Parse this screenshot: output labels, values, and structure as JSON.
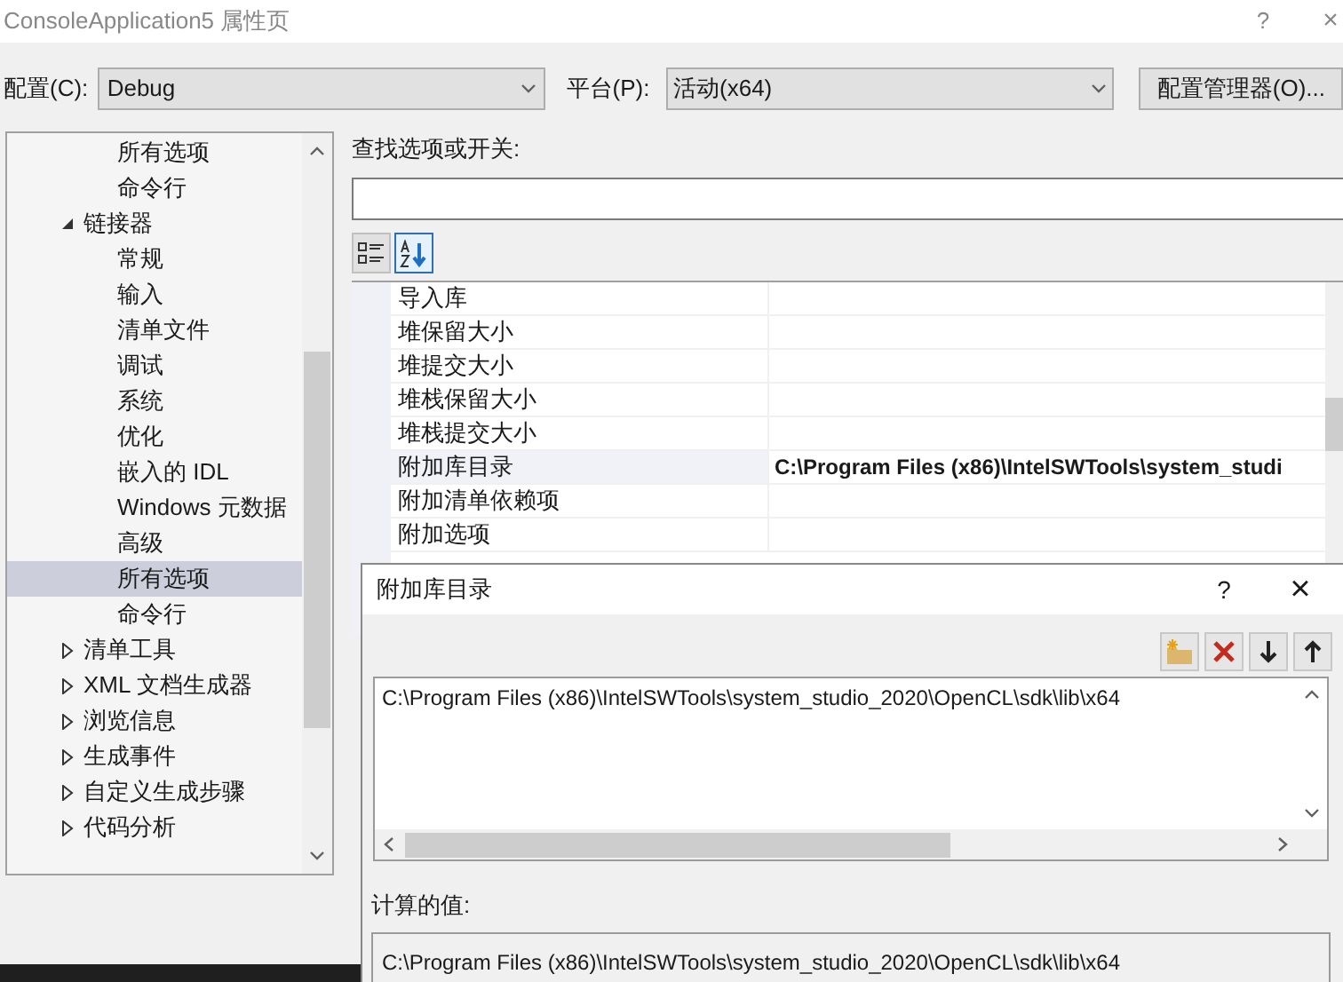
{
  "window": {
    "title": "ConsoleApplication5 属性页",
    "help": "?",
    "close": "×"
  },
  "config": {
    "label": "配置(C):",
    "value": "Debug"
  },
  "platform": {
    "label": "平台(P):",
    "value": "活动(x64)"
  },
  "config_manager_button": "配置管理器(O)...",
  "tree": [
    {
      "children": [
        {
          "label": "所有选项",
          "selected": false
        },
        {
          "label": "命令行",
          "selected": false
        }
      ]
    },
    {
      "label": "链接器",
      "expanded": true,
      "selected": false,
      "children": [
        {
          "label": "常规",
          "selected": false
        },
        {
          "label": "输入",
          "selected": false
        },
        {
          "label": "清单文件",
          "selected": false
        },
        {
          "label": "调试",
          "selected": false
        },
        {
          "label": "系统",
          "selected": false
        },
        {
          "label": "优化",
          "selected": false
        },
        {
          "label": "嵌入的 IDL",
          "selected": false
        },
        {
          "label": "Windows 元数据",
          "selected": false
        },
        {
          "label": "高级",
          "selected": false
        },
        {
          "label": "所有选项",
          "selected": true
        },
        {
          "label": "命令行",
          "selected": false
        }
      ]
    },
    {
      "label": "清单工具",
      "expanded": false,
      "selected": false
    },
    {
      "label": "XML 文档生成器",
      "expanded": false,
      "selected": false
    },
    {
      "label": "浏览信息",
      "expanded": false,
      "selected": false
    },
    {
      "label": "生成事件",
      "expanded": false,
      "selected": false
    },
    {
      "label": "自定义生成步骤",
      "expanded": false,
      "selected": false
    },
    {
      "label": "代码分析",
      "expanded": false,
      "selected": false
    }
  ],
  "search": {
    "label": "查找选项或开关:"
  },
  "view_buttons": [
    {
      "kind": "categorized",
      "selected": false
    },
    {
      "kind": "alphabetical",
      "selected": true
    }
  ],
  "properties": [
    {
      "name": "导入库",
      "selected": false
    },
    {
      "name": "堆保留大小",
      "selected": false
    },
    {
      "name": "堆提交大小",
      "selected": false
    },
    {
      "name": "堆栈保留大小",
      "selected": false
    },
    {
      "name": "堆栈提交大小",
      "selected": false
    },
    {
      "name": "附加库目录",
      "value": "C:\\Program Files (x86)\\IntelSWTools\\system_studi",
      "selected": true
    },
    {
      "name": "附加清单依赖项",
      "selected": false
    },
    {
      "name": "附加选项",
      "selected": false
    }
  ],
  "dialog": {
    "title": "附加库目录",
    "help": "?",
    "close": "×",
    "toolbar": [
      {
        "kind": "new-folder"
      },
      {
        "kind": "delete"
      },
      {
        "kind": "down"
      },
      {
        "kind": "up"
      }
    ],
    "entries": [
      "C:\\Program Files (x86)\\IntelSWTools\\system_studio_2020\\OpenCL\\sdk\\lib\\x64"
    ],
    "computed_label": "计算的值:",
    "computed_value": "C:\\Program Files (x86)\\IntelSWTools\\system_studio_2020\\OpenCL\\sdk\\lib\\x64"
  }
}
